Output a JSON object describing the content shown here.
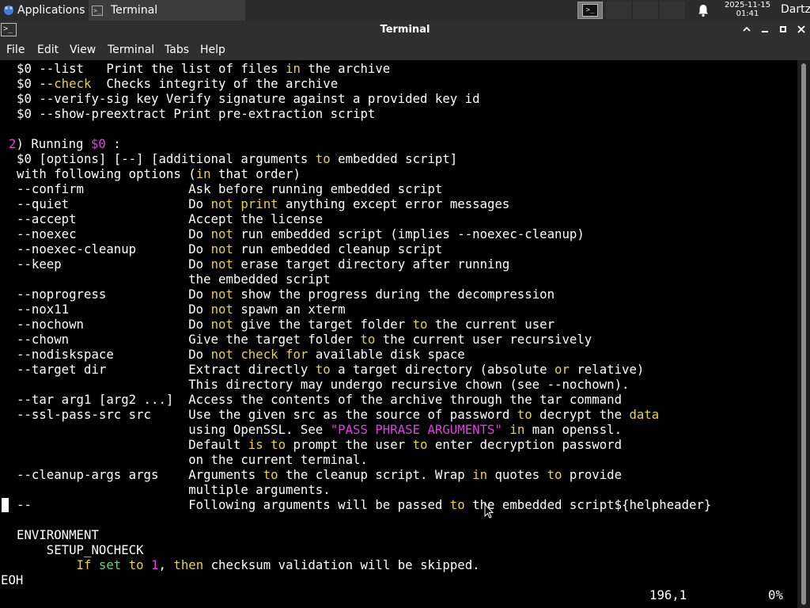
{
  "panel": {
    "apps_label": "Applications",
    "task_label": "Terminal",
    "clock_date": "2025-11-15",
    "clock_time": "01:41",
    "user": "Dartz"
  },
  "window": {
    "title": "Terminal"
  },
  "menu": [
    "File",
    "Edit",
    "View",
    "Terminal",
    "Tabs",
    "Help"
  ],
  "terminal": {
    "l1": [
      "$0 --list   Print the list of files ",
      "in",
      " the archive"
    ],
    "l2": [
      "$0 --",
      "check",
      "  Checks integrity of the archive"
    ],
    "l3": "$0 --verify-sig key Verify signature against a provided key id",
    "l4": "$0 --show-preextract Print pre-extraction script",
    "l6": [
      "2",
      ") Running ",
      "$0",
      " :"
    ],
    "l7": [
      "$0 [options] [--] [additional arguments ",
      "to",
      " embedded script]"
    ],
    "l8": [
      "with following options (",
      "in",
      " that order)"
    ],
    "opt_confirm": "--confirm              Ask before running embedded script",
    "opt_quiet": [
      "--quiet                Do ",
      "not",
      " ",
      "print",
      " anything except error messages"
    ],
    "opt_accept": "--accept               Accept the license",
    "opt_noexec": [
      "--noexec               Do ",
      "not",
      " run embedded script (implies --noexec-cleanup)"
    ],
    "opt_noexec_cleanup": [
      "--noexec-cleanup       Do ",
      "not",
      " run embedded cleanup script"
    ],
    "opt_keep": [
      "--keep                 Do ",
      "not",
      " erase target directory after running"
    ],
    "opt_keep_cont": "                       the embedded script",
    "opt_noprogress": [
      "--noprogress           Do ",
      "not",
      " show the progress during the decompression"
    ],
    "opt_nox11": [
      "--nox11                Do ",
      "not",
      " spawn an xterm"
    ],
    "opt_nochown": [
      "--nochown              Do ",
      "not",
      " give the target folder ",
      "to",
      " the current user"
    ],
    "opt_chown": [
      "--chown                Give the target folder ",
      "to",
      " the current user recursively"
    ],
    "opt_nodiskspace": [
      "--nodiskspace          Do ",
      "not",
      " ",
      "check",
      " ",
      "for",
      " available disk space"
    ],
    "opt_target": [
      "--target dir           Extract directly ",
      "to",
      " a target directory (absolute ",
      "or",
      " relative)"
    ],
    "opt_target_cont": "                       This directory may undergo recursive chown (see --nochown).",
    "opt_tar": "--tar arg1 [arg2 ...]  Access the contents of the archive through the tar command",
    "opt_ssl": [
      "--ssl-pass-src src     Use the given src as the source of password ",
      "to",
      " decrypt the ",
      "data"
    ],
    "opt_ssl_c1": [
      "                       using OpenSSL. See ",
      "\"PASS PHRASE ARGUMENTS\"",
      " ",
      "in",
      " man openssl."
    ],
    "opt_ssl_c2": [
      "                       Default ",
      "is",
      " ",
      "to",
      " prompt the user ",
      "to",
      " enter decryption password"
    ],
    "opt_ssl_c3": "                       on the current terminal.",
    "opt_cleanup": [
      "--cleanup-args args    Arguments ",
      "to",
      " the cleanup script. Wrap ",
      "in",
      " quotes ",
      "to",
      " provide"
    ],
    "opt_cleanup_cont": "                       multiple arguments.",
    "opt_dashdash": [
      "--                     Following arguments will be passed ",
      "to",
      " the embedded script${helpheader}"
    ],
    "env": "ENVIRONMENT",
    "env_var": "    SETUP_NOCHECK",
    "env_desc": [
      "        ",
      "If",
      " ",
      "set",
      " ",
      "to",
      " ",
      "1",
      ", ",
      "then",
      " checksum validation will be skipped."
    ],
    "eoh": "EOH",
    "status_pos": "196,1",
    "status_pct": "0%"
  }
}
